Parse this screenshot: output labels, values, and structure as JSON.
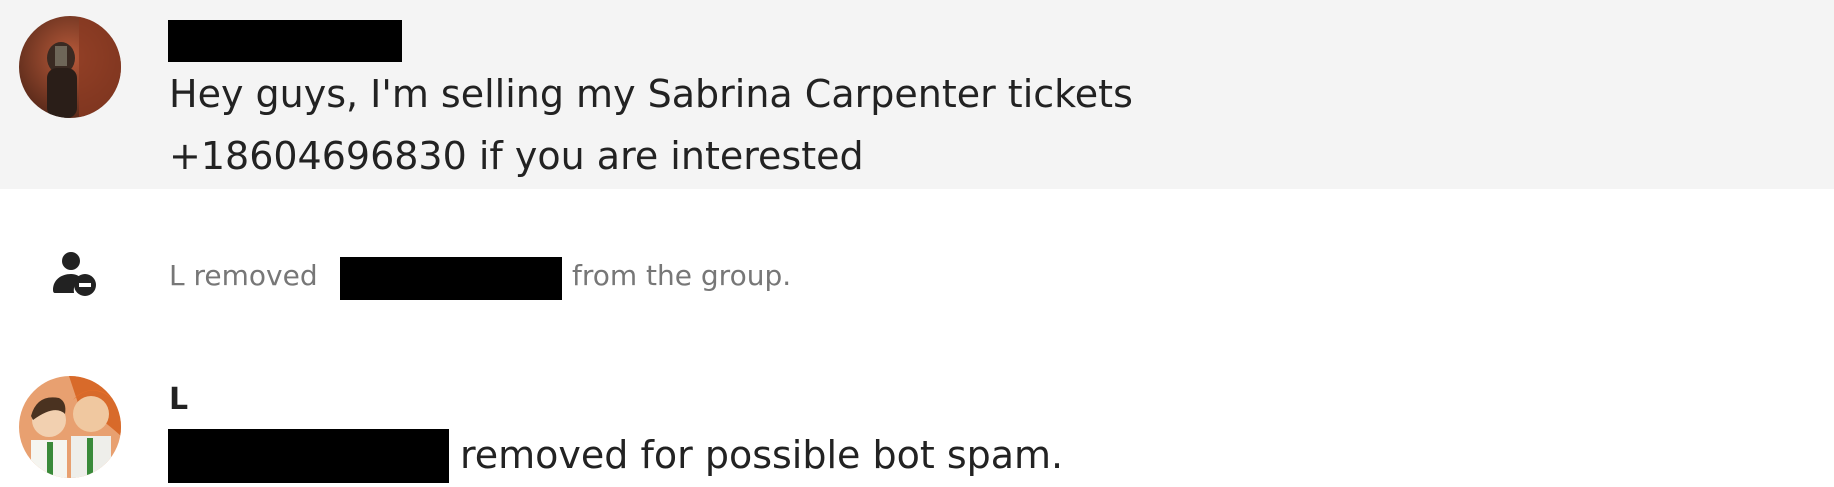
{
  "messages": [
    {
      "avatar": "user-photo-avatar",
      "sender": "[redacted]",
      "text_line_1": "Hey guys, I'm selling my Sabrina Carpenter tickets",
      "text_line_2": "+18604696830 if you are interested"
    }
  ],
  "system_event": {
    "icon": "remove-member-icon",
    "text_before": "L removed",
    "redacted": true,
    "text_after": "from the group."
  },
  "reply": {
    "avatar": "cartoon-avatar",
    "sender": "L",
    "text_after_redaction": "removed for possible bot spam."
  },
  "colors": {
    "highlight_bg": "#f4f4f4",
    "text": "#222222",
    "system_text": "#777777",
    "redaction": "#000000"
  }
}
